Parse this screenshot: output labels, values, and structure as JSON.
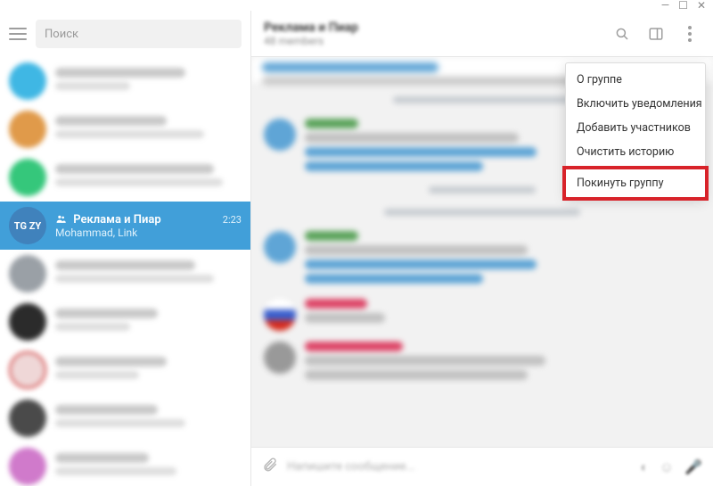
{
  "window_controls": {
    "min": "—",
    "max": "☐",
    "close": "✕"
  },
  "search": {
    "placeholder": "Поиск"
  },
  "chat_header": {
    "title": "Реклама и Пиар",
    "subtitle": "48 members"
  },
  "active_chat": {
    "name": "Реклама и Пиар",
    "time": "2:23",
    "subtitle": "Mohammad, Link",
    "avatar_text": "TG ZY"
  },
  "menu": {
    "about": "О группе",
    "notifications": "Включить уведомления",
    "add_members": "Добавить участников",
    "clear_history": "Очистить историю",
    "leave": "Покинуть группу"
  },
  "composer": {
    "placeholder": "Напишите сообщение..."
  },
  "blur_chats": [
    {
      "avatar": "#3fb7e4"
    },
    {
      "avatar": "#e09a4a"
    },
    {
      "avatar": "#35c77b"
    },
    {
      "avatar": "#d85f5f"
    },
    {
      "avatar": "#999"
    },
    {
      "avatar": "#333"
    },
    {
      "avatar": "#e8c9c9"
    },
    {
      "avatar": "#555"
    },
    {
      "avatar": "#d07acb"
    }
  ]
}
